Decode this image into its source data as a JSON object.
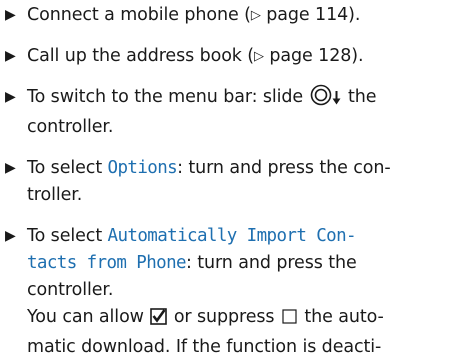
{
  "steps": [
    {
      "pre": "Connect a mobile phone (",
      "ref_symbol": "▷",
      "ref_text": " page 114)."
    },
    {
      "pre": "Call up the address book (",
      "ref_symbol": "▷",
      "ref_text": " page 128)."
    },
    {
      "pre": "To switch to the menu bar: slide ",
      "post": " the",
      "line2": "controller."
    },
    {
      "pre": "To select ",
      "ui": "Options",
      "post": ": turn and press the con-",
      "line2": "troller."
    },
    {
      "pre": "To select ",
      "ui1": "Automatically Import Con-",
      "ui2": "tacts from Phone",
      "post": ": turn and press the",
      "line3": "controller.",
      "note1_pre": "You can allow ",
      "note1_mid": " or suppress ",
      "note1_post": " the auto-",
      "note2": "matic download. If the function is deacti-"
    }
  ],
  "icons": {
    "bullet": "▶",
    "controller": "controller-icon",
    "slide_direction": "down-arrow-icon",
    "checked": "checkbox-checked-icon",
    "unchecked": "checkbox-unchecked-icon"
  },
  "colors": {
    "text": "#1a1a1a",
    "ui_term": "#1e6fb0"
  }
}
